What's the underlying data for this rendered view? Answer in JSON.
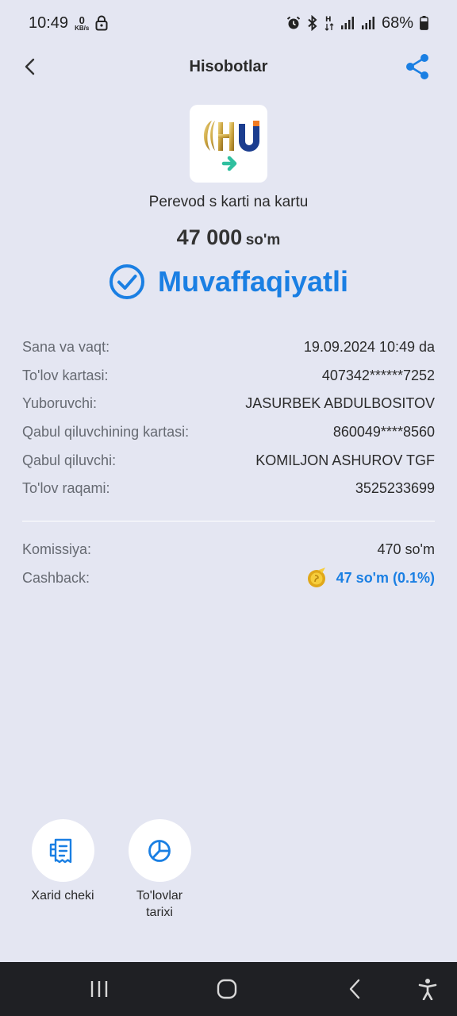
{
  "status_bar": {
    "time": "10:49",
    "net_speed": "0",
    "net_unit": "KB/s",
    "battery": "68%"
  },
  "header": {
    "title": "Hisobotlar"
  },
  "operation": {
    "name": "Perevod s karti na kartu",
    "amount": "47 000",
    "currency": "so'm",
    "status": "Muvaffaqiyatli"
  },
  "details": [
    {
      "key": "Sana va vaqt:",
      "value": "19.09.2024 10:49 da"
    },
    {
      "key": "To'lov kartasi:",
      "value": "407342******7252"
    },
    {
      "key": "Yuboruvchi:",
      "value": "JASURBEK ABDULBOSITOV"
    },
    {
      "key": "Qabul qiluvchining kartasi:",
      "value": "860049****8560"
    },
    {
      "key": "Qabul qiluvchi:",
      "value": "KOMILJON ASHUROV TGF"
    },
    {
      "key": "To'lov raqami:",
      "value": "3525233699"
    }
  ],
  "fees": {
    "commission_label": "Komissiya:",
    "commission_value": "470 so'm",
    "cashback_label": "Cashback:",
    "cashback_value": "47 so'm (0.1%)"
  },
  "actions": {
    "receipt_label": "Xarid cheki",
    "history_label_line1": "To'lovlar",
    "history_label_line2": "tarixi"
  },
  "colors": {
    "accent": "#1a7fe3",
    "background": "#e4e6f2",
    "nav_bar": "#1f2024"
  },
  "icons": [
    "back-arrow-icon",
    "share-icon",
    "check-circle-icon",
    "coin-icon",
    "receipt-icon",
    "pie-chart-icon"
  ]
}
